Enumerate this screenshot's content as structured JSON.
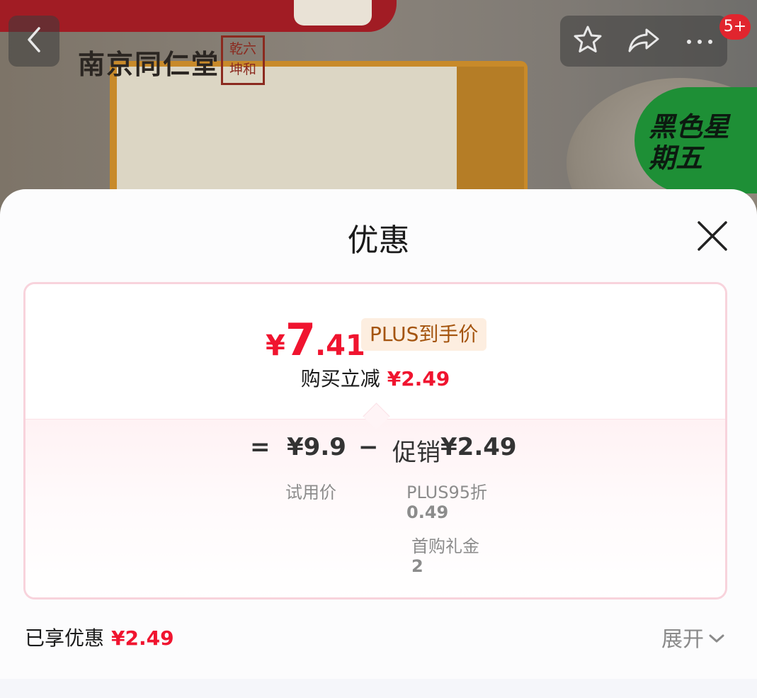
{
  "header": {
    "cart_badge": "5+",
    "icons": [
      "back-arrow-icon",
      "star-icon",
      "share-icon",
      "more-icon"
    ]
  },
  "background_image": {
    "brand_text": "南京同仁堂",
    "seal_text": "乾六坤和",
    "promo_sticker": "黑色星期五"
  },
  "sheet": {
    "title": "优惠",
    "card": {
      "price_currency": "¥",
      "price_integer": "7",
      "price_decimal": ".41",
      "price_tag": "PLUS到手价",
      "reduce_label": "购买立减",
      "reduce_amount": "¥2.49",
      "formula": {
        "equals": "=",
        "base_price": "¥9.9",
        "minus": "−",
        "promo_label": "促销",
        "promo_amount": "¥2.49",
        "base_caption": "试用价",
        "detail_1_label": "PLUS95折",
        "detail_1_value": "0.49",
        "detail_2_label": "首购礼金",
        "detail_2_value": "2"
      }
    },
    "enjoyed_label": "已享优惠",
    "enjoyed_amount": "¥2.49",
    "expand_label": "展开"
  },
  "colors": {
    "accent_red": "#f0142f",
    "tag_bg": "#fdeee0",
    "tag_text": "#a4540e",
    "card_border": "#f8d3dc"
  }
}
